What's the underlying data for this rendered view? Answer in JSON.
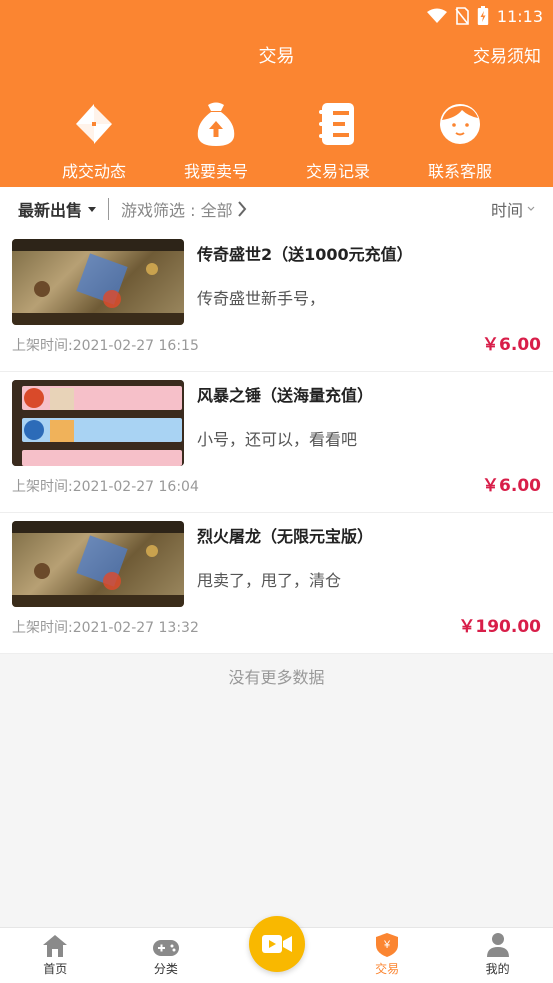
{
  "status": {
    "time": "11:13"
  },
  "header": {
    "title": "交易",
    "notice": "交易须知",
    "quick": [
      {
        "label": "成交动态",
        "icon": "pinwheel-icon"
      },
      {
        "label": "我要卖号",
        "icon": "money-bag-icon"
      },
      {
        "label": "交易记录",
        "icon": "record-list-icon"
      },
      {
        "label": "联系客服",
        "icon": "customer-service-icon"
      }
    ]
  },
  "filters": {
    "latest": "最新出售",
    "game_filter": "游戏筛选 : 全部",
    "time": "时间"
  },
  "listings": [
    {
      "title": "传奇盛世2（送1000元充值）",
      "desc": "传奇盛世新手号，",
      "time": "上架时间:2021-02-27 16:15",
      "price": "￥6.00",
      "thumb": "game"
    },
    {
      "title": "风暴之锤（送海量充值）",
      "desc": "小号，还可以，看看吧",
      "time": "上架时间:2021-02-27 16:04",
      "price": "￥6.00",
      "thumb": "rank"
    },
    {
      "title": "烈火屠龙（无限元宝版）",
      "desc": "甩卖了，甩了，清仓",
      "time": "上架时间:2021-02-27 13:32",
      "price": "￥190.00",
      "thumb": "game"
    }
  ],
  "no_more": "没有更多数据",
  "nav": [
    {
      "label": "首页",
      "icon": "home-icon"
    },
    {
      "label": "分类",
      "icon": "gamepad-icon"
    },
    {
      "label": "",
      "icon": "video-camera-icon"
    },
    {
      "label": "交易",
      "icon": "trade-shield-icon",
      "active": true
    },
    {
      "label": "我的",
      "icon": "person-icon"
    }
  ],
  "colors": {
    "brand": "#fb8531",
    "price": "#d81e49",
    "center_button": "#f9b800"
  }
}
